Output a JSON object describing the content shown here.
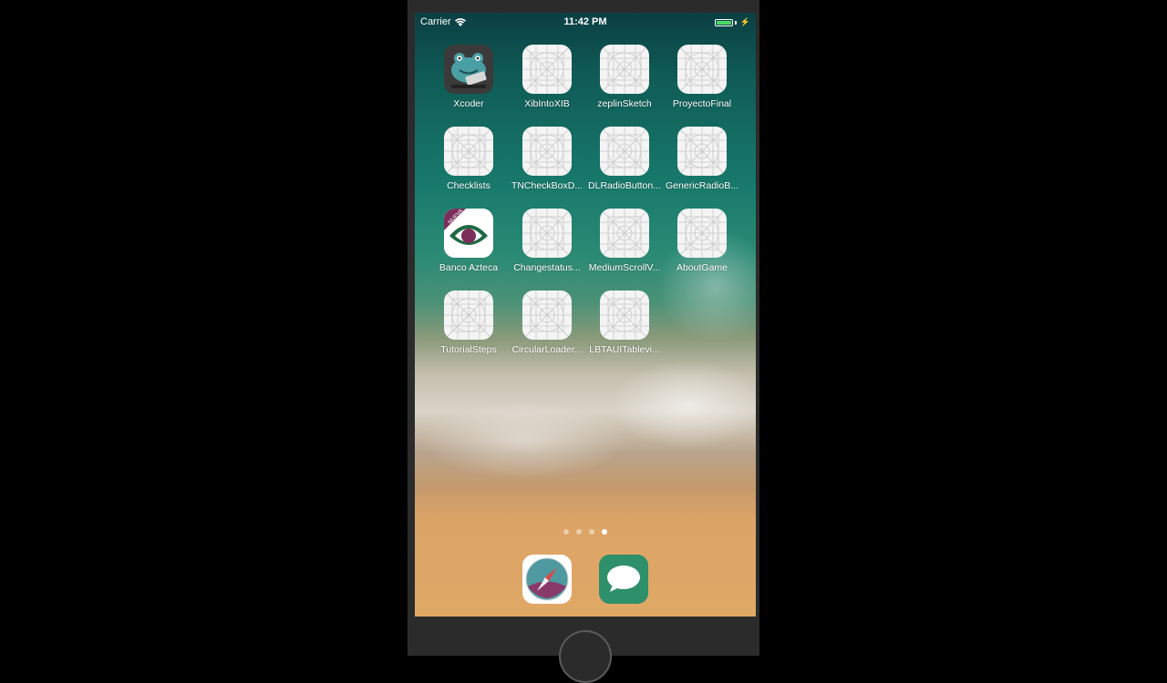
{
  "status_bar": {
    "carrier": "Carrier",
    "time": "11:42 PM",
    "wifi_icon": "wifi-icon",
    "battery_icon": "battery-charging-icon",
    "battery_color": "#4cd964"
  },
  "apps": [
    {
      "label": "Xcoder",
      "icon": "xcoder-frog-icon"
    },
    {
      "label": "XibIntoXIB",
      "icon": "placeholder-app-icon"
    },
    {
      "label": "zeplinSketch",
      "icon": "placeholder-app-icon"
    },
    {
      "label": "ProyectoFinal",
      "icon": "placeholder-app-icon"
    },
    {
      "label": "Checklists",
      "icon": "placeholder-app-icon"
    },
    {
      "label": "TNCheckBoxD...",
      "icon": "placeholder-app-icon"
    },
    {
      "label": "DLRadioButton...",
      "icon": "placeholder-app-icon"
    },
    {
      "label": "GenericRadioB...",
      "icon": "placeholder-app-icon"
    },
    {
      "label": "Banco Azteca",
      "icon": "banco-azteca-icon",
      "badge_text": "NUEVA"
    },
    {
      "label": "Changestatus...",
      "icon": "placeholder-app-icon"
    },
    {
      "label": "MediumScrollV...",
      "icon": "placeholder-app-icon"
    },
    {
      "label": "AboutGame",
      "icon": "placeholder-app-icon"
    },
    {
      "label": "TutorialSteps",
      "icon": "placeholder-app-icon"
    },
    {
      "label": "CircularLoader...",
      "icon": "placeholder-app-icon"
    },
    {
      "label": "LBTAUITablevi...",
      "icon": "placeholder-app-icon"
    }
  ],
  "page_indicator": {
    "pages": 4,
    "current": 4
  },
  "dock": [
    {
      "name": "safari",
      "icon": "safari-compass-icon"
    },
    {
      "name": "messages",
      "icon": "messages-bubble-icon"
    }
  ],
  "colors": {
    "messages_green": "#2e8f6b",
    "safari_teal": "#4f9aa0",
    "azteca_green": "#1f6a44",
    "azteca_purple": "#7a2e5a"
  }
}
